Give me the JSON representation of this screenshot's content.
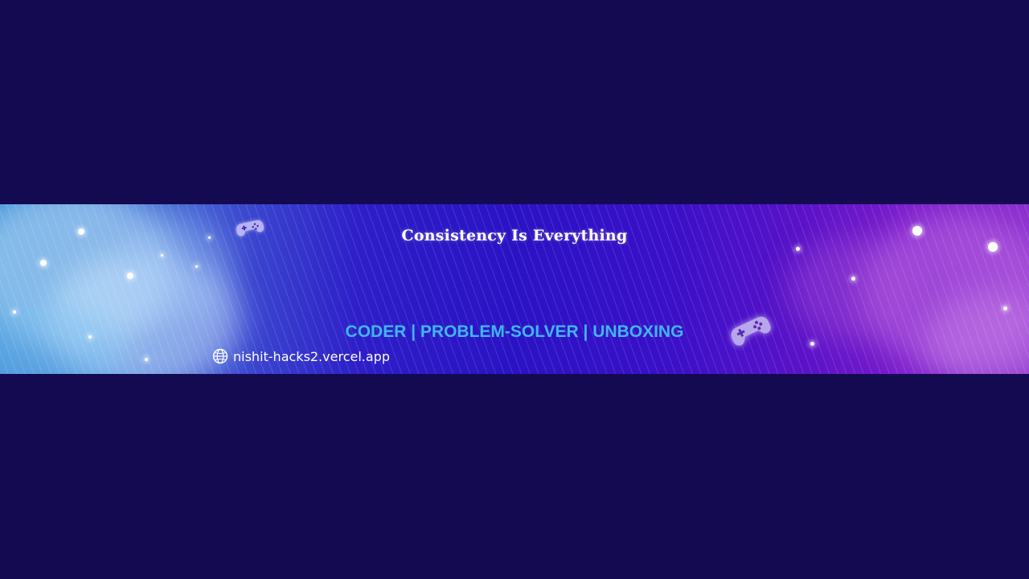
{
  "banner": {
    "title": "Consistency Is Everything",
    "tagline": "CODER | PROBLEM-SOLVER | UNBOXING",
    "website": "nishit-hacks2.vercel.app",
    "icons": {
      "globe": "globe-icon",
      "gamepad": "gamepad-icon"
    },
    "colors": {
      "background": "#130a52",
      "tagline": "#3fb6f0",
      "title": "#ffffff"
    }
  }
}
